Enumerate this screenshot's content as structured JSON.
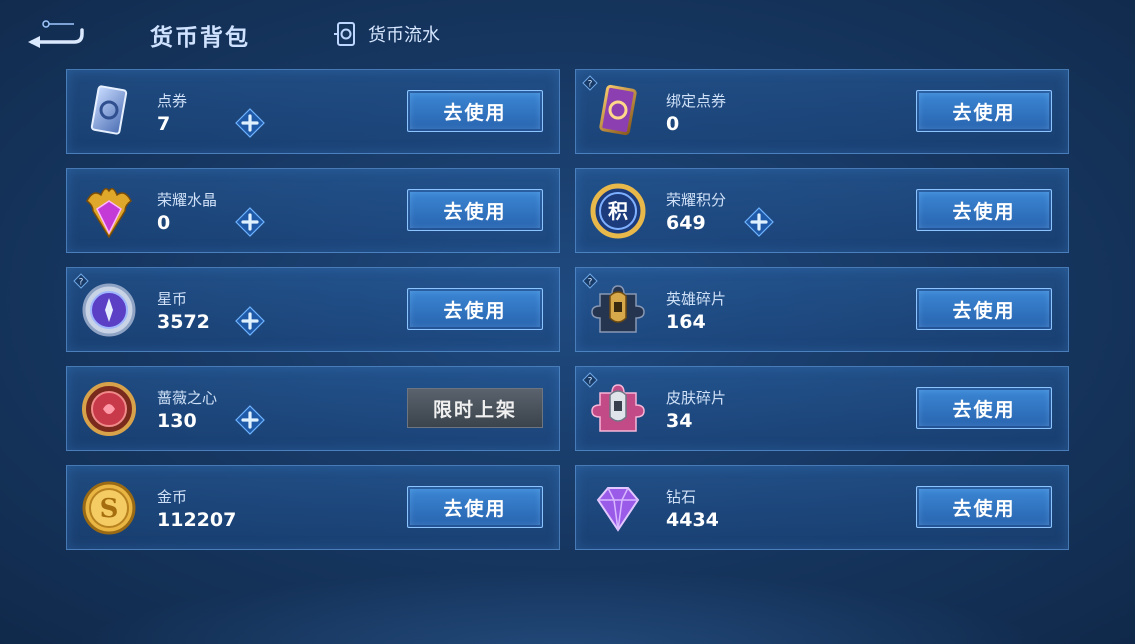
{
  "header": {
    "title": "货币背包",
    "flow_label": "货币流水"
  },
  "cards": [
    {
      "name": "点券",
      "value": "7",
      "button": "去使用",
      "icon": "ticket-icon",
      "has_plus": true,
      "has_info": false
    },
    {
      "name": "绑定点券",
      "value": "0",
      "button": "去使用",
      "icon": "bound-ticket-icon",
      "has_plus": false,
      "has_info": true
    },
    {
      "name": "荣耀水晶",
      "value": "0",
      "button": "去使用",
      "icon": "glory-crystal-icon",
      "has_plus": true,
      "has_info": false
    },
    {
      "name": "荣耀积分",
      "value": "649",
      "button": "去使用",
      "icon": "glory-points-icon",
      "has_plus": true,
      "has_info": false
    },
    {
      "name": "星币",
      "value": "3572",
      "button": "去使用",
      "icon": "star-coin-icon",
      "has_plus": true,
      "has_info": true
    },
    {
      "name": "英雄碎片",
      "value": "164",
      "button": "去使用",
      "icon": "hero-fragment-icon",
      "has_plus": false,
      "has_info": true
    },
    {
      "name": "蔷薇之心",
      "value": "130",
      "button": "限时上架",
      "icon": "rose-heart-icon",
      "has_plus": true,
      "has_info": false
    },
    {
      "name": "皮肤碎片",
      "value": "34",
      "button": "去使用",
      "icon": "skin-fragment-icon",
      "has_plus": false,
      "has_info": true
    },
    {
      "name": "金币",
      "value": "112207",
      "button": "去使用",
      "icon": "gold-coin-icon",
      "has_plus": false,
      "has_info": false
    },
    {
      "name": "钻石",
      "value": "4434",
      "button": "去使用",
      "icon": "diamond-icon",
      "has_plus": false,
      "has_info": false
    }
  ],
  "colors": {
    "background": "#173863",
    "card_border": "#6eaaeb",
    "use_button": "#3c88d6",
    "limited_button": "#4a525b",
    "plus_accent": "#8fd0ff"
  }
}
